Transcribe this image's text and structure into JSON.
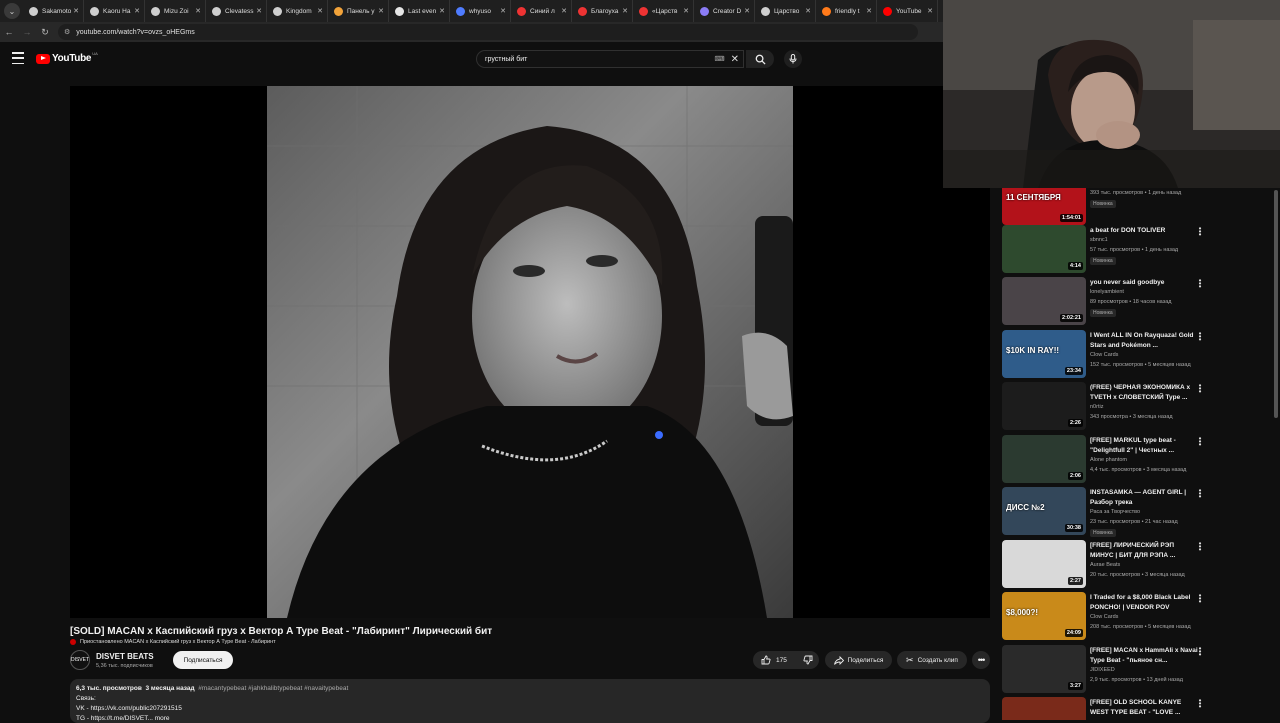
{
  "browser": {
    "tabs": [
      {
        "label": "Sakamoto",
        "color": "#cfcfcf"
      },
      {
        "label": "Kaoru Ha",
        "color": "#cfcfcf"
      },
      {
        "label": "Mizu Zoi",
        "color": "#cfcfcf"
      },
      {
        "label": "Clevatess",
        "color": "#cfcfcf"
      },
      {
        "label": "Kingdom",
        "color": "#cfcfcf"
      },
      {
        "label": "Панель у",
        "color": "#f2a33a"
      },
      {
        "label": "Last even",
        "color": "#e7e7e7"
      },
      {
        "label": "whyuso",
        "color": "#4f7cff"
      },
      {
        "label": "Синий л",
        "color": "#e33"
      },
      {
        "label": "Благоуха",
        "color": "#e33"
      },
      {
        "label": "«Царств",
        "color": "#e33"
      },
      {
        "label": "Creator D",
        "color": "#8b7cf6"
      },
      {
        "label": "Царство",
        "color": "#cfcfcf"
      },
      {
        "label": "friendly t",
        "color": "#ff7a1a"
      },
      {
        "label": "YouTube",
        "color": "#ff0000"
      }
    ],
    "url": "youtube.com/watch?v=ovzs_oHEGms"
  },
  "header": {
    "logo": "YouTube",
    "region": "UA",
    "search_query": "грустный бит"
  },
  "video": {
    "title": "[SOLD] MACAN x Каспийский груз x Вектор А Type Beat - \"Лабиринт\" Лирический бит",
    "subtitle": "Приостановлено MACAN x Каспийский груз x Вектор А Type Beat - Лабиринт",
    "channel": "DISVET BEATS",
    "avatar_text": "DISVET",
    "subscribers": "5,36 тыс. подписчиков",
    "subscribe_label": "Подписаться",
    "likes": "175",
    "share_label": "Поделиться",
    "clip_label": "Создать клип",
    "description": {
      "views": "6,3 тыс. просмотров",
      "age": "3 месяца назад",
      "tags": "#macantypebeat #jahkhalibtypebeat #navaitypebeat",
      "line2": "Связь:",
      "line3": "VK - https://vk.com/public207291515",
      "line4": "TG - https://t.me/DISVET... more"
    }
  },
  "recommendations": [
    {
      "title": "",
      "channel": "Минута в минуту",
      "views": "393 тыс. просмотров • 1 день назад",
      "duration": "1:54:01",
      "badge": "Новинка",
      "thumb_overlay": "11 СЕНТЯБРЯ",
      "thumb_bg": "#b3121a"
    },
    {
      "title": "a beat for DON TOLIVER",
      "channel": "sbnnc1",
      "views": "57 тыс. просмотров • 1 день назад",
      "duration": "4:14",
      "badge": "Новинка",
      "thumb_overlay": "",
      "thumb_bg": "#2e4a2e"
    },
    {
      "title": "you never said goodbye",
      "channel": "lonelyambient",
      "views": "89 просмотров • 18 часов назад",
      "duration": "2:02:21",
      "badge": "Новинка",
      "thumb_overlay": "",
      "thumb_bg": "#4a4448"
    },
    {
      "title": "I Went ALL IN On Rayquaza! Gold Stars and Pokémon ...",
      "channel": "Clow Cards",
      "views": "152 тыс. просмотров • 5 месяцев назад",
      "duration": "23:34",
      "badge": "",
      "thumb_overlay": "$10K IN RAY!!",
      "thumb_bg": "#2f5c8a"
    },
    {
      "title": "(FREE) ЧЕРНАЯ ЭКОНОМИКА x TVETH x СЛОВЕТСКИЙ Type ...",
      "channel": "n0rtiz",
      "views": "343 просмотра • 3 месяца назад",
      "duration": "2:26",
      "badge": "",
      "thumb_overlay": "",
      "thumb_bg": "#1c1c1c"
    },
    {
      "title": "[FREE] MARKUL type beat - \"Delightfull 2\" | Честных ...",
      "channel": "Alone phantom",
      "views": "4,4 тыс. просмотров • 3 месяца назад",
      "duration": "2:06",
      "badge": "",
      "thumb_overlay": "",
      "thumb_bg": "#2b3a30"
    },
    {
      "title": "INSTASAMKA — AGENT GIRL | Разбор трека",
      "channel": "Раса за Творчество",
      "views": "23 тыс. просмотров • 21 час назад",
      "duration": "30:38",
      "badge": "Новинка",
      "thumb_overlay": "ДИСС №2",
      "thumb_bg": "#33475a"
    },
    {
      "title": "[FREE] ЛИРИЧЕСКИЙ РЭП МИНУС | БИТ ДЛЯ РЭПА ...",
      "channel": "Aurae Beats",
      "views": "20 тыс. просмотров • 3 месяца назад",
      "duration": "2:27",
      "badge": "",
      "thumb_overlay": "",
      "thumb_bg": "#d9d9d9"
    },
    {
      "title": "I Traded for a $8,000 Black Label PONCHO! | VENDOR POV",
      "channel": "Clow Cards",
      "views": "208 тыс. просмотров • 5 месяцев назад",
      "duration": "24:09",
      "badge": "",
      "thumb_overlay": "$8,000?!",
      "thumb_bg": "#c98a1a"
    },
    {
      "title": "[FREE] MACAN x HammAli x Navai Type Beat - \"пьяное сн...",
      "channel": "JIDIXEED",
      "views": "2,9 тыс. просмотров • 13 дней назад",
      "duration": "3:27",
      "badge": "",
      "thumb_overlay": "",
      "thumb_bg": "#2a2a2a"
    },
    {
      "title": "[FREE] OLD SCHOOL KANYE WEST TYPE BEAT - \"LOVE ...",
      "channel": "",
      "views": "",
      "duration": "",
      "badge": "",
      "thumb_overlay": "",
      "thumb_bg": "#7a2a1a"
    }
  ]
}
